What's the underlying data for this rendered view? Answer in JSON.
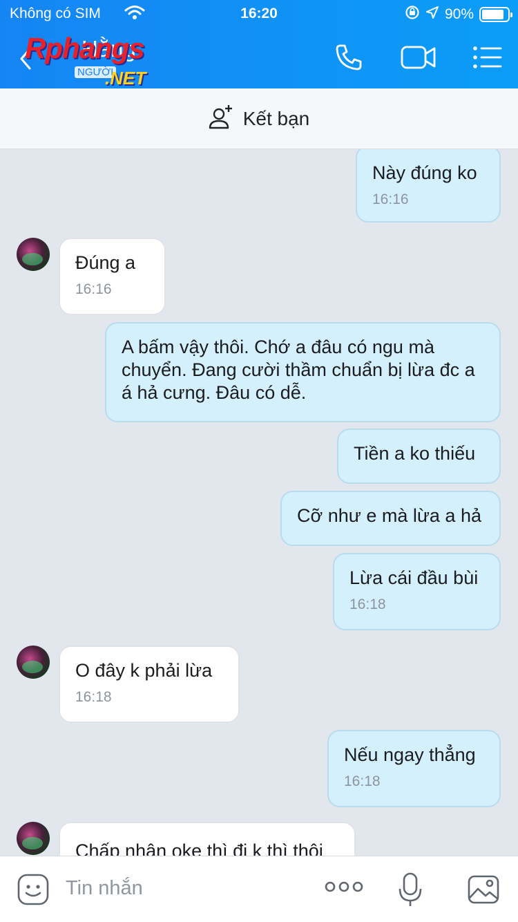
{
  "status_bar": {
    "carrier": "Không có SIM",
    "time": "16:20",
    "battery": "90%"
  },
  "header": {
    "title": "Hằng",
    "subtitle": "NGƯỜI",
    "watermark_main": "Rphangs",
    "watermark_sub": ".NET"
  },
  "friend_bar": {
    "label": "Kết bạn"
  },
  "messages": [
    {
      "from": "me",
      "text": "Này đúng ko",
      "time": "16:16"
    },
    {
      "from": "them",
      "text": "Đúng a",
      "time": "16:16"
    },
    {
      "from": "me",
      "text": "A bấm vậy thôi. Chớ a đâu có ngu mà chuyển. Đang cười thầm chuẩn bị lừa đc a á hả cưng. Đâu có dễ.",
      "time": ""
    },
    {
      "from": "me",
      "text": "Tiền a ko thiếu",
      "time": ""
    },
    {
      "from": "me",
      "text": "Cỡ như e mà lừa a hả",
      "time": ""
    },
    {
      "from": "me",
      "text": "Lừa cái đầu bùi",
      "time": "16:18"
    },
    {
      "from": "them",
      "text": "O đây k phải lừa",
      "time": "16:18"
    },
    {
      "from": "me",
      "text": "Nếu ngay thẳng",
      "time": "16:18"
    },
    {
      "from": "them",
      "text": "Chấp nhận oke thì đi k thì thôi",
      "time": ""
    }
  ],
  "input": {
    "placeholder": "Tin nhắn"
  },
  "colors": {
    "header": "#1585f3",
    "my_bubble": "#d4f0fd",
    "their_bubble": "#ffffff",
    "background": "#e2e7ee"
  }
}
